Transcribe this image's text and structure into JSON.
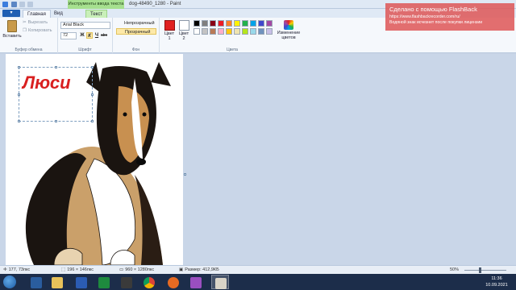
{
  "window": {
    "title": "dog-48490_1280 - Paint",
    "context_tab_title": "Инструменты ввода текста"
  },
  "ribbon_tabs": {
    "file": "",
    "home": "Главная",
    "view": "Вид",
    "text": "Текст"
  },
  "clipboard": {
    "paste": "Вставить",
    "cut": "Вырезать",
    "copy": "Копировать",
    "group_label": "Буфер обмена"
  },
  "font": {
    "family": "Arial Black",
    "size": "72",
    "bold": "Ж",
    "italic": "К",
    "underline": "Ч",
    "strike": "abc",
    "group_label": "Шрифт"
  },
  "background": {
    "opaque": "Непрозрачный",
    "transparent": "Прозрачный",
    "group_label": "Фон"
  },
  "colors": {
    "color1_label": "Цвет 1",
    "color2_label": "Цвет 2",
    "edit_colors": "Изменение цветов",
    "group_label": "Цвета",
    "color1": "#e02020",
    "color2": "#ffffff",
    "palette": [
      "#000000",
      "#7f7f7f",
      "#880015",
      "#ed1c24",
      "#ff7f27",
      "#fff200",
      "#22b14c",
      "#00a2e8",
      "#3f48cc",
      "#a349a4",
      "#ffffff",
      "#c3c3c3",
      "#b97a57",
      "#ffaec9",
      "#ffc90e",
      "#efe4b0",
      "#b5e61d",
      "#99d9ea",
      "#7092be",
      "#c8bfe7"
    ]
  },
  "canvas": {
    "text": "Люси",
    "text_color": "#d92020"
  },
  "watermark": {
    "title": "Сделано с помощью FlashBack",
    "url": "https://www.flashbackrecorder.com/ru/",
    "note": "Водяной знак исчезнет после покупки лицензии"
  },
  "status": {
    "cursor": "177, 73пкс",
    "selection": "196 × 146пкс",
    "image_size": "960 × 1280пкс",
    "file_size": "Размер: 412,9КБ",
    "zoom": "50%"
  },
  "taskbar": {
    "time": "11:36",
    "date": "10.09.2021"
  }
}
